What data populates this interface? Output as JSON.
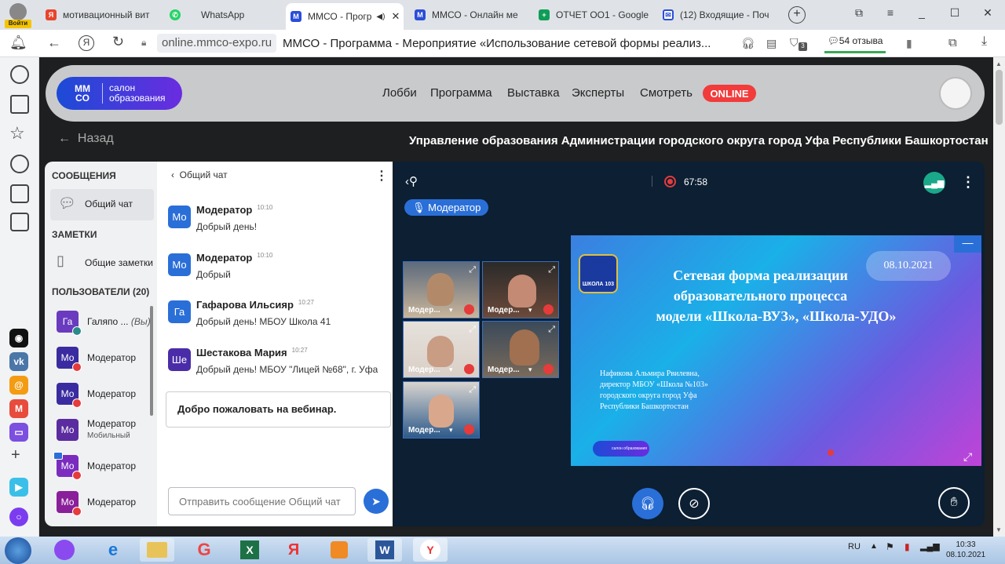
{
  "browser": {
    "login_badge": "Войти",
    "tabs": [
      {
        "label": "мотивационный вит",
        "icon": "yandex-icon",
        "color": "#e8452c"
      },
      {
        "label": "WhatsApp",
        "icon": "whatsapp-icon",
        "color": "#25d366"
      },
      {
        "label": "ММСО - Прогр",
        "icon": "mmco-icon",
        "color": "#2b4ed8"
      },
      {
        "label": "ММСО - Онлайн ме",
        "icon": "mmco-icon",
        "color": "#2b4ed8"
      },
      {
        "label": "ОТЧЕТ ОО1 - Google",
        "icon": "sheets-icon",
        "color": "#0f9d58"
      },
      {
        "label": "(12) Входящие - Поч",
        "icon": "mail-icon",
        "color": "#2b4ed8"
      }
    ],
    "url_domain": "online.mmco-expo.ru",
    "page_title": "ММСО - Программа - Мероприятие «Использование сетевой формы реализ...",
    "reviews": "54 отзыва",
    "tab_count": "3"
  },
  "site": {
    "logo_line1": "салон",
    "logo_line2": "образования",
    "logo_mark": "MM CO",
    "nav": [
      "Лобби",
      "Программа",
      "Выставка",
      "Эксперты",
      "Смотреть"
    ],
    "online_badge": "ONLINE",
    "back": "Назад",
    "organizer": "Управление образования Администрации городского округа город Уфа Республики Башкортостан"
  },
  "leftpanel": {
    "messages_header": "СООБЩЕНИЯ",
    "general_chat": "Общий чат",
    "notes_header": "ЗАМЕТКИ",
    "general_notes": "Общие заметки",
    "users_header": "ПОЛЬЗОВАТЕЛИ (20)",
    "users": [
      {
        "initials": "Га",
        "name": "Галяпо ...",
        "suffix": "(Вы)",
        "color": "#6a3bbf"
      },
      {
        "initials": "Мо",
        "name": "Модератор",
        "color": "#3a2ca0"
      },
      {
        "initials": "Мо",
        "name": "Модератор",
        "color": "#3a2ca0"
      },
      {
        "initials": "Мо",
        "name": "Модератор",
        "sub": "Мобильный",
        "color": "#5a2ca0"
      },
      {
        "initials": "Мо",
        "name": "Модератор",
        "color": "#7b2cbf"
      },
      {
        "initials": "Мо",
        "name": "Модератор",
        "color": "#8a1f9a"
      }
    ]
  },
  "chat": {
    "header": "Общий чат",
    "messages": [
      {
        "initials": "Мо",
        "author": "Модератор",
        "time": "10:10",
        "text": "Добрый день!",
        "color": "#2a6fd8"
      },
      {
        "initials": "Мо",
        "author": "Модератор",
        "time": "10:10",
        "text": "Добрый",
        "color": "#2a6fd8"
      },
      {
        "initials": "Га",
        "author": "Гафарова Ильсияр",
        "time": "10:27",
        "text": "Добрый день! МБОУ Школа 41",
        "color": "#2a6fd8"
      },
      {
        "initials": "Ше",
        "author": "Шестакова Мария",
        "time": "10:27",
        "text": "Добрый день! МБОУ \"Лицей №68\", г. Уфа",
        "color": "#4a2ca8"
      }
    ],
    "welcome": "Добро пожаловать на вебинар.",
    "input_placeholder": "Отправить сообщение Общий чат"
  },
  "video": {
    "timer": "67:58",
    "moderator_badge": "Модератор",
    "tiles": [
      "Модер...",
      "Модер...",
      "Модер...",
      "Модер...",
      "Модер..."
    ],
    "slide": {
      "date": "08.10.2021",
      "school_badge": "ШКОЛА 103",
      "title_line1": "Сетевая форма реализации",
      "title_line2": "образовательного процесса",
      "title_line3": "модели «Школа-ВУЗ», «Школа-УДО»",
      "author_line1": "Нафикова Альмира Рвилевна,",
      "author_line2": "директор МБОУ «Школа №103»",
      "author_line3": "городского округа город Уфа",
      "author_line4": "Республики Башкортостан",
      "logo_text": "салон образования"
    }
  },
  "taskbar": {
    "lang": "RU",
    "time": "10:33",
    "date": "08.10.2021"
  }
}
